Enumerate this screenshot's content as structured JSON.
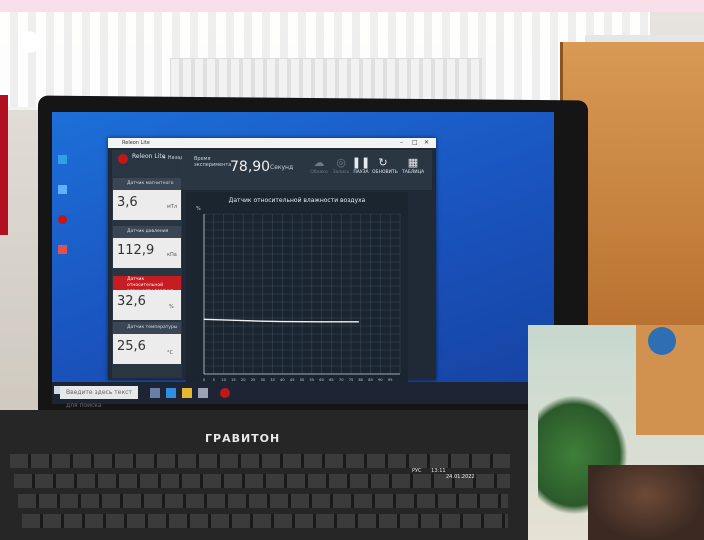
{
  "app": {
    "title": "Releon Lite",
    "logo_text": "Releon Lite",
    "add_label": "+ Назад",
    "time_label": "Время эксперимента",
    "time_value": "78,90",
    "time_unit": "Секунд",
    "tools": [
      {
        "label": "Облако",
        "icon": "cloud-icon",
        "dim": true
      },
      {
        "label": "Запись",
        "icon": "record-icon",
        "dim": true
      },
      {
        "label": "ПАУЗА",
        "icon": "pause-icon",
        "dim": false
      },
      {
        "label": "ОБНОВИТЬ",
        "icon": "refresh-icon",
        "dim": false
      },
      {
        "label": "ТАБЛИЦА",
        "icon": "table-icon",
        "dim": false
      }
    ],
    "sensors": [
      {
        "name": "Датчик магнитного поля",
        "value": "3,6",
        "unit": "мТл",
        "active": false
      },
      {
        "name": "Датчик давления",
        "value": "112,9",
        "unit": "кПа",
        "active": false
      },
      {
        "name": "Датчик относительной влажности воздуха",
        "value": "32,6",
        "unit": "%",
        "active": true
      },
      {
        "name": "Датчик температуры воды",
        "value": "25,6",
        "unit": "°C",
        "active": false
      }
    ],
    "chart_title": "Датчик относительной влажности воздуха"
  },
  "chart_data": {
    "type": "line",
    "title": "Датчик относительной влажности воздуха",
    "ylabel": "%",
    "xlim": [
      0,
      100
    ],
    "ylim": [
      0,
      100
    ],
    "x_ticks": [
      0,
      5,
      10,
      15,
      20,
      25,
      30,
      35,
      40,
      45,
      50,
      55,
      60,
      65,
      70,
      75,
      80,
      85,
      90,
      95
    ],
    "series": [
      {
        "color": "#f2f2f2",
        "x": [
          0,
          10,
          20,
          30,
          40,
          50,
          60,
          70,
          78.9
        ],
        "y": [
          34.2,
          33.8,
          33.4,
          33.0,
          32.8,
          32.7,
          32.6,
          32.6,
          32.6
        ]
      }
    ],
    "grid": true
  },
  "taskbar": {
    "search_placeholder": "Введите здесь текст для поиска",
    "time": "13:11",
    "date": "24.01.2022",
    "lang": "РУС"
  },
  "laptop": {
    "brand": "ГРАВИТОН"
  },
  "colors": {
    "accent_red": "#c51d23",
    "screen_blue": "#1a54bf",
    "app_dark": "#1f2a36"
  }
}
